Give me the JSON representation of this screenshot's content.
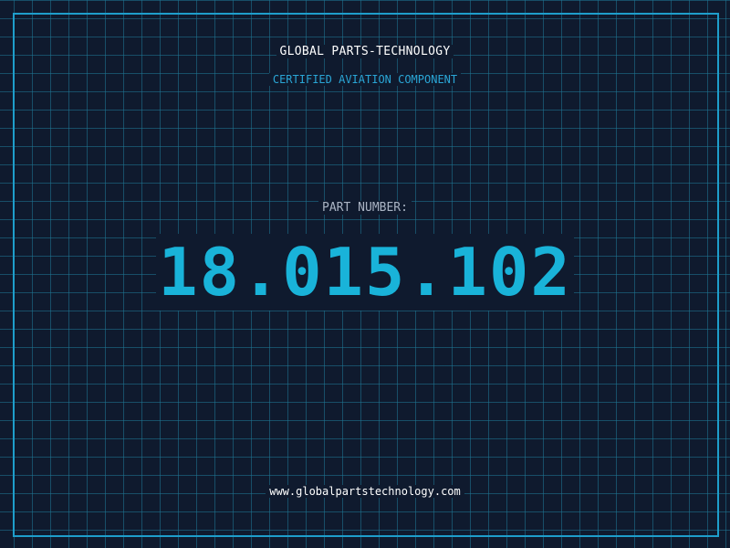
{
  "header": {
    "company": "GLOBAL PARTS-TECHNOLOGY",
    "tagline": "CERTIFIED AVIATION COMPONENT"
  },
  "part": {
    "label": "PART NUMBER:",
    "number": "18.015.102"
  },
  "footer": {
    "website": "www.globalpartstechnology.com"
  },
  "colors": {
    "background": "#0f1a2e",
    "grid": "#1e7896",
    "frame": "#1e9ecb",
    "accent": "#19b3d9"
  }
}
